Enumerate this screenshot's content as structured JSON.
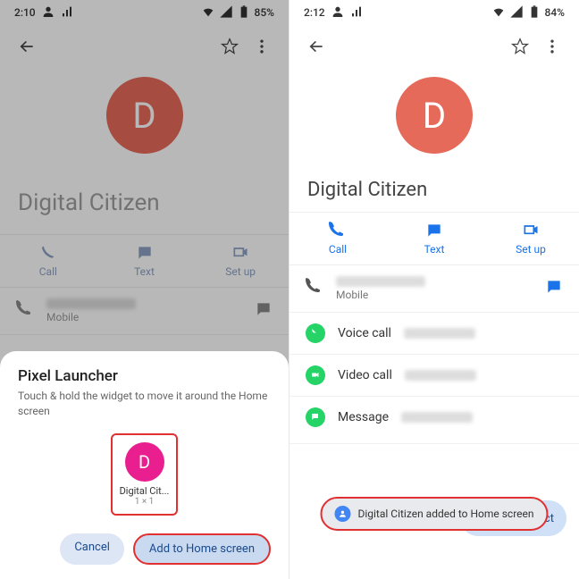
{
  "left": {
    "status": {
      "time": "2:10",
      "battery": "85%"
    },
    "avatar_letter": "D",
    "contact_name": "Digital Citizen",
    "actions": {
      "call": "Call",
      "text": "Text",
      "setup": "Set up"
    },
    "mobile": "Mobile",
    "sheet": {
      "title": "Pixel Launcher",
      "desc": "Touch & hold the widget to move it around the Home screen",
      "widget_letter": "D",
      "widget_label": "Digital Cit...",
      "widget_size": "1 × 1",
      "cancel": "Cancel",
      "add": "Add to Home screen"
    }
  },
  "right": {
    "status": {
      "time": "2:12",
      "battery": "84%"
    },
    "avatar_letter": "D",
    "contact_name": "Digital Citizen",
    "actions": {
      "call": "Call",
      "text": "Text",
      "setup": "Set up"
    },
    "mobile": "Mobile",
    "voice": "Voice call",
    "video": "Video call",
    "msg": "Message",
    "toast": "Digital Citizen added to Home screen",
    "edit": "Edit contact"
  }
}
